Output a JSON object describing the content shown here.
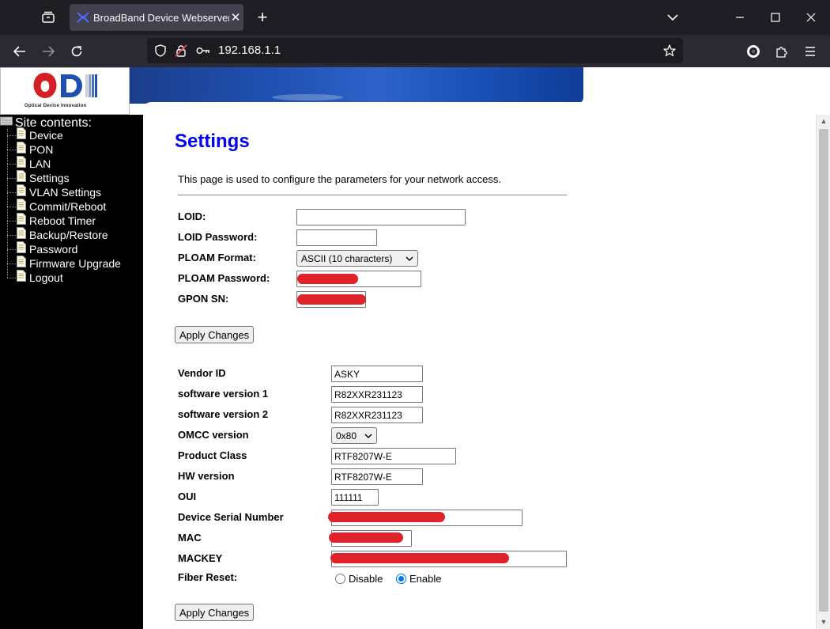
{
  "browser": {
    "tab_title": "BroadBand Device Webserver",
    "tab_close": "✕",
    "new_tab": "+",
    "url": "192.168.1.1",
    "theme_colors": {
      "tabbar": "#1f1e25",
      "navbar": "#2b2a33",
      "urlbar": "#1c1b22",
      "tab_active": "#42414d"
    }
  },
  "logo": {
    "text": "ODI",
    "subtitle": "Optical Device Innovation",
    "colors": {
      "red": "#d32027",
      "blue": "#1f4fb0"
    }
  },
  "sidebar": {
    "title": "Site contents:",
    "items": [
      {
        "label": "Device"
      },
      {
        "label": "PON"
      },
      {
        "label": "LAN"
      },
      {
        "label": "Settings"
      },
      {
        "label": "VLAN Settings"
      },
      {
        "label": "Commit/Reboot"
      },
      {
        "label": "Reboot Timer"
      },
      {
        "label": "Backup/Restore"
      },
      {
        "label": "Password"
      },
      {
        "label": "Firmware Upgrade"
      },
      {
        "label": "Logout"
      }
    ]
  },
  "main": {
    "title": "Settings",
    "description": "This page is used to configure the parameters for your network access.",
    "title_color": "#0000ee",
    "form1": {
      "loid": {
        "label": "LOID:",
        "value": ""
      },
      "loid_password": {
        "label": "LOID Password:",
        "value": ""
      },
      "ploam_format": {
        "label": "PLOAM Format:",
        "selected": "ASCII (10 characters)"
      },
      "ploam_password": {
        "label": "PLOAM Password:",
        "redacted": true
      },
      "gpon_sn": {
        "label": "GPON SN:",
        "redacted": true
      },
      "apply_label": "Apply Changes"
    },
    "form2": {
      "vendor_id": {
        "label": "Vendor ID",
        "value": "ASKY"
      },
      "sw_version1": {
        "label": "software version 1",
        "value": "R82XXR231123"
      },
      "sw_version2": {
        "label": "software version 2",
        "value": "R82XXR231123"
      },
      "omcc_version": {
        "label": "OMCC version",
        "selected": "0x80"
      },
      "product_class": {
        "label": "Product Class",
        "value": "RTF8207W-E"
      },
      "hw_version": {
        "label": "HW version",
        "value": "RTF8207W-E"
      },
      "oui": {
        "label": "OUI",
        "value": "111111"
      },
      "device_serial": {
        "label": "Device Serial Number",
        "redacted": true
      },
      "mac": {
        "label": "MAC",
        "redacted": true
      },
      "mackey": {
        "label": "MACKEY",
        "redacted": true
      },
      "fiber_reset": {
        "label": "Fiber Reset:",
        "options": [
          "Disable",
          "Enable"
        ],
        "selected": "Enable"
      },
      "apply_label": "Apply Changes"
    }
  }
}
